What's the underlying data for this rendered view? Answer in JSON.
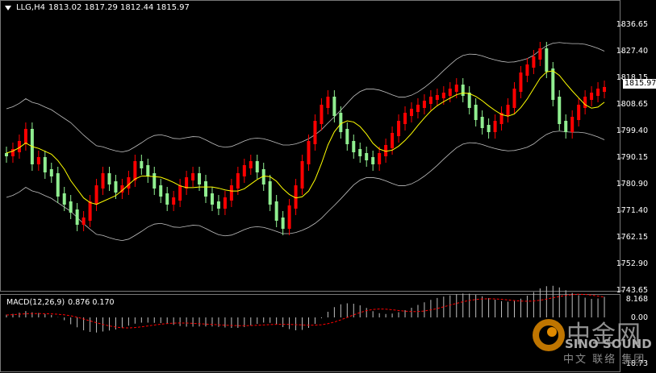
{
  "header": {
    "symbol": "LLG,H4",
    "ohlc": "1813.02 1817.29 1812.44 1815.97"
  },
  "macd": {
    "label": "MACD(12,26,9)",
    "values": "0.876 0.170",
    "scale_top": "8.168",
    "scale_zero": "0.00",
    "scale_bottom": "-18.73"
  },
  "price_axis": [
    "1836.65",
    "1827.40",
    "1818.15",
    "1808.65",
    "1799.40",
    "1790.15",
    "1780.90",
    "1771.40",
    "1762.15",
    "1752.90",
    "1743.65"
  ],
  "current_price": "1815.97",
  "logo": {
    "cn": "中金网",
    "en": "SINO SOUND",
    "sub": "中文 联络 集团"
  },
  "colors": {
    "up": "#ff0000",
    "down": "#90ee90",
    "bands": "#c0c0c0",
    "ma": "#ffff00",
    "macd_signal": "#ff0000",
    "macd_hist": "#c0c0c0"
  }
}
